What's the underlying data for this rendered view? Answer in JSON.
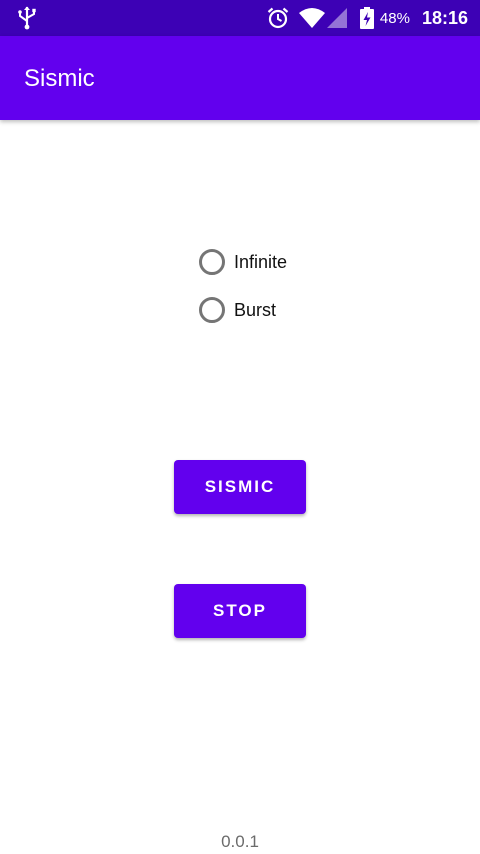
{
  "status_bar": {
    "battery_percent": "48%",
    "time": "18:16",
    "icons": [
      "usb-icon",
      "alarm-icon",
      "wifi-icon",
      "signal-icon",
      "battery-charging-icon"
    ]
  },
  "app_bar": {
    "title": "Sismic"
  },
  "mode_options": [
    {
      "label": "Infinite",
      "selected": false
    },
    {
      "label": "Burst",
      "selected": false
    }
  ],
  "buttons": {
    "sismic_label": "SISMIC",
    "stop_label": "STOP"
  },
  "footer": {
    "version": "0.0.1"
  },
  "colors": {
    "primary": "#6200ee",
    "status_bar": "#3d01b5",
    "on_primary": "#ffffff",
    "radio_border": "#757575"
  }
}
